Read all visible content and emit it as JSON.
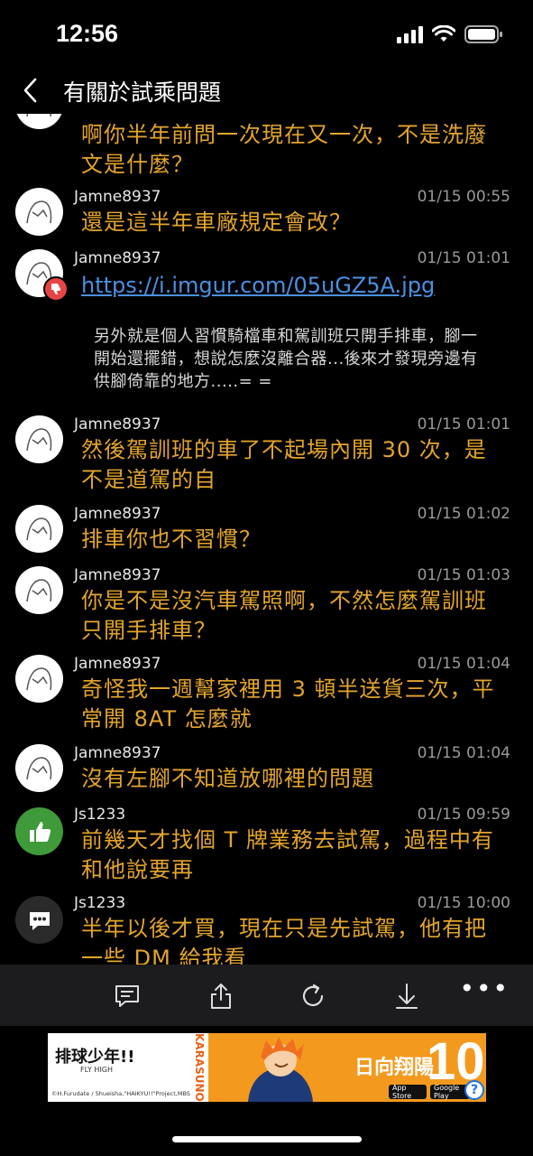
{
  "status_bar": {
    "time": "12:56"
  },
  "nav": {
    "title": "有關於試乘問題"
  },
  "messages": [
    {
      "text": "啊你半年前問一次現在又一次，不是洗廢文是什麼？"
    },
    {
      "username": "Jamne8937",
      "time": "01/15 00:55",
      "text": "還是這半年車廠規定會改？"
    },
    {
      "username": "Jamne8937",
      "time": "01/15 01:01",
      "link": "https://i.imgur.com/05uGZ5A.jpg",
      "quote": "另外就是個人習慣騎檔車和駕訓班只開手排車，腳一開始還擺錯，想說怎麼沒離合器...後來才發現旁邊有供腳倚靠的地方.....= ="
    },
    {
      "username": "Jamne8937",
      "time": "01/15 01:01",
      "text": "然後駕訓班的車了不起場內開 30 次，是不是道駕的自"
    },
    {
      "username": "Jamne8937",
      "time": "01/15 01:02",
      "text": "排車你也不習慣？"
    },
    {
      "username": "Jamne8937",
      "time": "01/15 01:03",
      "text": "你是不是沒汽車駕照啊，不然怎麼駕訓班只開手排車？"
    },
    {
      "username": "Jamne8937",
      "time": "01/15 01:04",
      "text": "奇怪我一週幫家裡用 3 頓半送貨三次，平常開 8AT 怎麼就"
    },
    {
      "username": "Jamne8937",
      "time": "01/15 01:04",
      "text": "沒有左腳不知道放哪裡的問題"
    },
    {
      "username": "Js1233",
      "time": "01/15 09:59",
      "text": "前幾天才找個 T 牌業務去試駕，過程中有和他說要再"
    },
    {
      "username": "Js1233",
      "time": "01/15 10:00",
      "text": "半年以後才買，現在只是先試駕，他有把一些 DM 給我看"
    }
  ],
  "toolbar": {
    "more_label": "•••"
  },
  "ad": {
    "logo": "排球少年!!",
    "logo_sub": "FLY HIGH",
    "copyright": "©H.Furudate / Shueisha,\"HAIKYU!!\"Project,MBS",
    "brand": "KARASUNO",
    "headline": "日向翔陽",
    "number": "10",
    "app_store": "App Store",
    "google_play": "Google Play",
    "help": "?"
  },
  "colors": {
    "message_text": "#e4a52c",
    "link": "#4a90e2",
    "background": "#000000",
    "toolbar": "#1c1c1e"
  }
}
